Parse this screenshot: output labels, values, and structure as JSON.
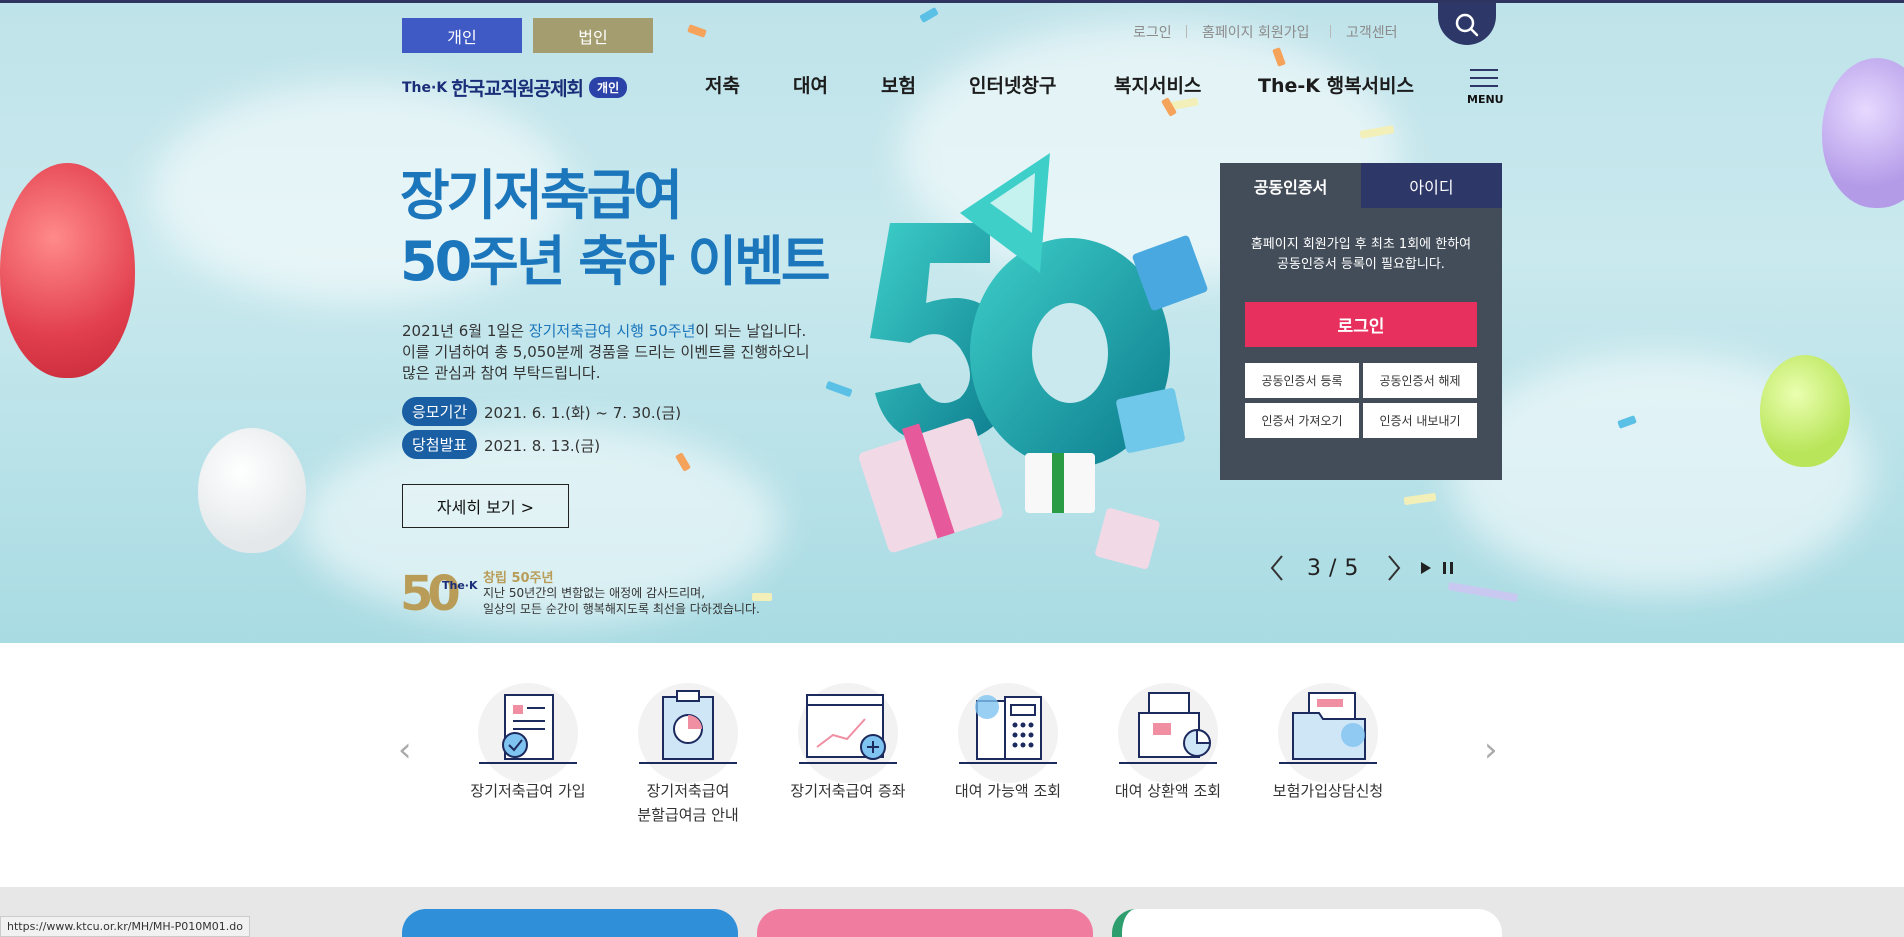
{
  "user_type": {
    "individual": "개인",
    "corporate": "법인"
  },
  "util_nav": [
    "로그인",
    "홈페이지 회원가입",
    "고객센터"
  ],
  "logo": {
    "brand": "The·K",
    "name": "한국교직원공제회",
    "badge": "개인"
  },
  "gnb": [
    "저축",
    "대여",
    "보험",
    "인터넷창구",
    "복지서비스",
    "The-K 행복서비스"
  ],
  "menu_label": "MENU",
  "hero": {
    "title_line1": "장기저축급여",
    "title_line2": "50주년 축하 이벤트",
    "desc_1a": "2021년 6월 1일은 ",
    "desc_1b": "장기저축급여 시행 50주년",
    "desc_1c": "이 되는 날입니다.",
    "desc_2": "이를 기념하여 총 5,050분께 경품을 드리는 이벤트를 진행하오니",
    "desc_3": "많은 관심과 참여 부탁드립니다.",
    "period_label": "응모기간",
    "period_value": "2021. 6. 1.(화) ~ 7. 30.(금)",
    "announce_label": "당첨발표",
    "announce_value": "2021. 8. 13.(금)",
    "detail_button": "자세히 보기 >"
  },
  "anniversary": {
    "number": "50",
    "brand": "The·K",
    "title": "창립 50주년",
    "line1": "지난 50년간의 변함없는 애정에 감사드리며,",
    "line2": "일상의 모든 순간이 행복해지도록 최선을 다하겠습니다."
  },
  "login_panel": {
    "tab_cert": "공동인증서",
    "tab_id": "아이디",
    "note_1": "홈페이지 회원가입 후 최초 1회에 한하여",
    "note_2": "공동인증서 등록이 필요합니다.",
    "login_button": "로그인",
    "cert_register": "공동인증서 등록",
    "cert_release": "공동인증서 해제",
    "cert_import": "인증서 가져오기",
    "cert_export": "인증서 내보내기"
  },
  "slider": {
    "current": "3",
    "separator": "/",
    "total": "5"
  },
  "quick_menu": [
    {
      "label": "장기저축급여 가입",
      "label2": ""
    },
    {
      "label": "장기저축급여",
      "label2": "분할급여금 안내"
    },
    {
      "label": "장기저축급여 증좌",
      "label2": ""
    },
    {
      "label": "대여 가능액 조회",
      "label2": ""
    },
    {
      "label": "대여 상환액 조회",
      "label2": ""
    },
    {
      "label": "보험가입상담신청",
      "label2": ""
    }
  ],
  "status_url": "https://www.ktcu.or.kr/MH/MH-P010M01.do",
  "colors": {
    "primary_blue": "#1b76bc",
    "navy": "#2e3868",
    "login_pink": "#e8305e",
    "gold": "#b89c57"
  }
}
